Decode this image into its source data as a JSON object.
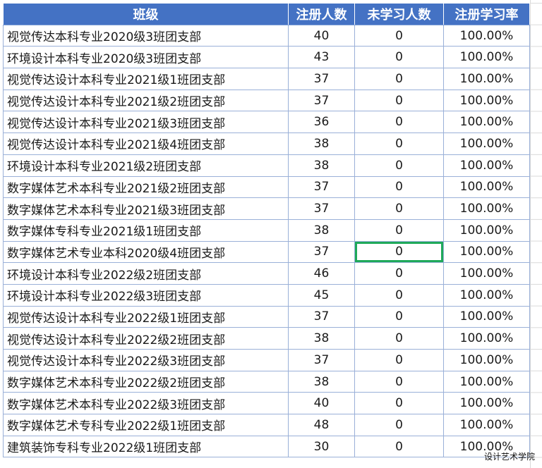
{
  "table": {
    "headers": [
      "班级",
      "注册人数",
      "未学习人数",
      "注册学习率"
    ],
    "rows": [
      [
        "视觉传达本科专业2020级3班团支部",
        "40",
        "0",
        "100.00%"
      ],
      [
        "环境设计本科专业2020级3班团支部",
        "43",
        "0",
        "100.00%"
      ],
      [
        "视觉传达设计本科专业2021级1班团支部",
        "37",
        "0",
        "100.00%"
      ],
      [
        "视觉传达设计本科专业2021级2班团支部",
        "37",
        "0",
        "100.00%"
      ],
      [
        "视觉传达设计本科专业2021级3班团支部",
        "36",
        "0",
        "100.00%"
      ],
      [
        "视觉传达设计本科专业2021级4班团支部",
        "38",
        "0",
        "100.00%"
      ],
      [
        "环境设计本科专业2021级2班团支部",
        "38",
        "0",
        "100.00%"
      ],
      [
        "数字媒体艺术本科专业2021级2班团支部",
        "37",
        "0",
        "100.00%"
      ],
      [
        "数字媒体艺术本科专业2021级3班团支部",
        "37",
        "0",
        "100.00%"
      ],
      [
        "数字媒体专科专业2021级1班团支部",
        "38",
        "0",
        "100.00%"
      ],
      [
        "数字媒体艺术专业本科2020级4班团支部",
        "37",
        "0",
        "100.00%"
      ],
      [
        "环境设计本科专业2022级2班团支部",
        "46",
        "0",
        "100.00%"
      ],
      [
        "环境设计本科专业2022级3班团支部",
        "45",
        "0",
        "100.00%"
      ],
      [
        "视觉传达设计本科专业2022级1班团支部",
        "37",
        "0",
        "100.00%"
      ],
      [
        "视觉传达设计本科专业2022级2班团支部",
        "38",
        "0",
        "100.00%"
      ],
      [
        "视觉传达设计本科专业2022级3班团支部",
        "37",
        "0",
        "100.00%"
      ],
      [
        "数字媒体艺术本科专业2022级2班团支部",
        "38",
        "0",
        "100.00%"
      ],
      [
        "数字媒体艺术本科专业2022级3班团支部",
        "40",
        "0",
        "100.00%"
      ],
      [
        "数字媒体艺术专科专业2022级1班团支部",
        "48",
        "0",
        "100.00%"
      ],
      [
        "建筑装饰专科专业2022级1班团支部",
        "30",
        "0",
        "100.00%"
      ]
    ],
    "selected_cell": {
      "row": 10,
      "col": 2
    }
  },
  "watermark": "设计艺术学院",
  "colors": {
    "header_bg": "#4472c4",
    "header_text": "#ffffff",
    "grid_border": "#9ab0d8",
    "selection": "#1fa95a"
  }
}
